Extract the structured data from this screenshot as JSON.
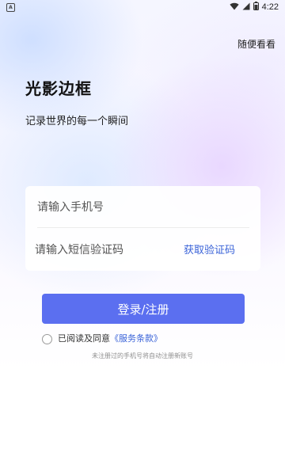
{
  "status_bar": {
    "app_icon_letter": "A",
    "time": "4:22",
    "icons": [
      "wifi-icon",
      "signal-icon",
      "battery-icon"
    ]
  },
  "header": {
    "skip_label": "随便看看"
  },
  "brand": {
    "title": "光影边框",
    "subtitle": "记录世界的每一个瞬间"
  },
  "form": {
    "phone_placeholder": "请输入手机号",
    "code_placeholder": "请输入短信验证码",
    "get_code_label": "获取验证码"
  },
  "actions": {
    "login_label": "登录/注册"
  },
  "agreement": {
    "prefix": "已阅读及同意",
    "terms_label": "《服务条款》",
    "checked": false
  },
  "hint": "未注册过的手机号将自动注册新账号",
  "colors": {
    "accent": "#5b6ff0",
    "link": "#3a63d8"
  }
}
